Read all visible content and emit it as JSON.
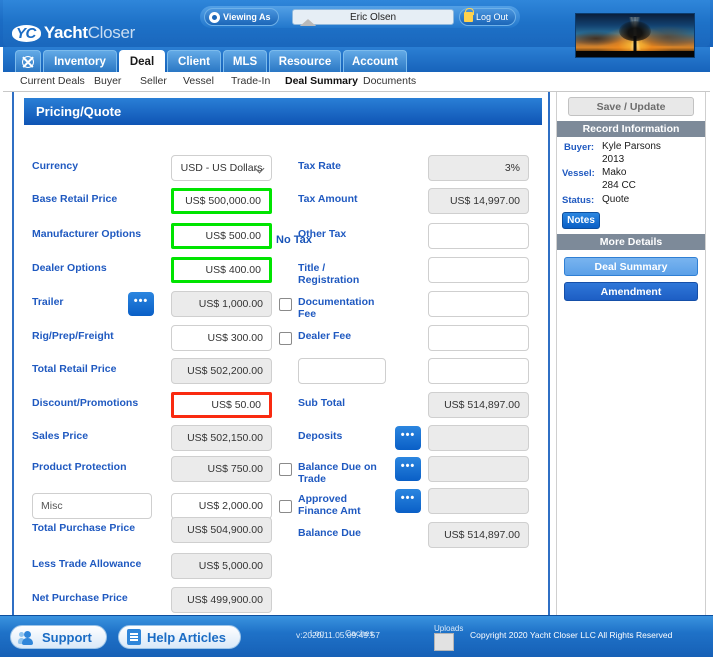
{
  "header": {
    "logo_yc": "YC",
    "logo_yacht": "Yacht",
    "logo_closer": "Closer",
    "viewing_as_label": "Viewing As",
    "viewing_user": "Eric Olsen",
    "logout_label": "Log Out"
  },
  "nav": {
    "tabs": [
      {
        "label": "",
        "icon": "helm-icon",
        "active": false
      },
      {
        "label": "Inventory",
        "active": false
      },
      {
        "label": "Deal",
        "active": true
      },
      {
        "label": "Client",
        "active": false
      },
      {
        "label": "MLS",
        "active": false
      },
      {
        "label": "Resource",
        "active": false
      },
      {
        "label": "Account",
        "active": false
      }
    ],
    "subnav": [
      {
        "label": "Current Deals",
        "active": false
      },
      {
        "label": "Buyer",
        "active": false
      },
      {
        "label": "Seller",
        "active": false
      },
      {
        "label": "Vessel",
        "active": false
      },
      {
        "label": "Trade-In",
        "active": false
      },
      {
        "label": "Deal Summary",
        "active": true
      },
      {
        "label": "Documents",
        "active": false
      }
    ]
  },
  "panel": {
    "title": "Pricing/Quote",
    "no_tax_label": "No Tax"
  },
  "left_fields": [
    {
      "label": "Currency",
      "value": "USD - US Dollars",
      "type": "select"
    },
    {
      "label": "Base Retail Price",
      "value": "US$ 500,000.00",
      "type": "input",
      "highlight": "green"
    },
    {
      "label": "Manufacturer Options",
      "value": "US$ 500.00",
      "type": "input",
      "highlight": "green"
    },
    {
      "label": "Dealer Options",
      "value": "US$ 400.00",
      "type": "input",
      "highlight": "green"
    },
    {
      "label": "Trailer",
      "value": "US$ 1,000.00",
      "type": "readonly",
      "dots": true
    },
    {
      "label": "Rig/Prep/Freight",
      "value": "US$ 300.00",
      "type": "input"
    },
    {
      "label": "Total Retail Price",
      "value": "US$ 502,200.00",
      "type": "readonly"
    },
    {
      "label": "Discount/Promotions",
      "value": "US$ 50.00",
      "type": "input",
      "highlight": "red"
    },
    {
      "label": "Sales Price",
      "value": "US$ 502,150.00",
      "type": "readonly"
    },
    {
      "label": "Product Protection",
      "value": "US$ 750.00",
      "type": "readonly"
    },
    {
      "label": "Misc",
      "value": "US$ 2,000.00",
      "type": "input",
      "label_is_input": true
    },
    {
      "label": "Total Purchase Price",
      "value": "US$ 504,900.00",
      "type": "readonly"
    },
    {
      "label": "Less Trade Allowance",
      "value": "US$ 5,000.00",
      "type": "readonly"
    },
    {
      "label": "Net Purchase Price",
      "value": "US$ 499,900.00",
      "type": "readonly"
    }
  ],
  "right_fields": [
    {
      "label": "Tax Rate",
      "value": "3%",
      "type": "readonly"
    },
    {
      "label": "Tax Amount",
      "value": "US$ 14,997.00",
      "type": "readonly"
    },
    {
      "label": "Other Tax",
      "value": "",
      "type": "input"
    },
    {
      "label": "Title / Registration",
      "value": "",
      "type": "input"
    },
    {
      "label": "Documentation Fee",
      "value": "",
      "type": "input"
    },
    {
      "label": "Dealer Fee",
      "value": "",
      "type": "input"
    },
    {
      "label": "",
      "value": "",
      "type": "input",
      "label_is_input": true,
      "label_value": ""
    },
    {
      "label": "Sub Total",
      "value": "US$ 514,897.00",
      "type": "readonly"
    },
    {
      "label": "Deposits",
      "value": "",
      "type": "readonly",
      "dots": true
    },
    {
      "label": "Balance Due on Trade",
      "value": "",
      "type": "readonly",
      "dots": true
    },
    {
      "label": "Approved Finance Amt",
      "value": "",
      "type": "readonly",
      "dots": true
    },
    {
      "label": "Balance Due",
      "value": "US$ 514,897.00",
      "type": "readonly"
    }
  ],
  "sidebar": {
    "save_label": "Save / Update",
    "record_header": "Record Information",
    "buyer_key": "Buyer:",
    "buyer_name": "Kyle Parsons",
    "buyer_year": "2013",
    "vessel_key": "Vessel:",
    "vessel_make": "Mako",
    "vessel_model": "284 CC",
    "status_key": "Status:",
    "status_value": "Quote",
    "notes_label": "Notes",
    "more_details_header": "More Details",
    "deal_summary_label": "Deal Summary",
    "amendment_label": "Amendment"
  },
  "footer": {
    "support_label": "Support",
    "help_label": "Help Articles",
    "log_label": "Log",
    "caches_label": "Caches",
    "version": "v:2020.11.05.09.49.57",
    "uploads_label": "Uploads",
    "copyright": "Copyright 2020 Yacht Closer LLC All Rights Reserved"
  },
  "colors": {
    "brand_blue": "#1b6cc4",
    "label_blue": "#1f59c0",
    "highlight_green": "#00e400",
    "highlight_red": "#f92a10",
    "sidebar_header": "#7d8a99"
  }
}
